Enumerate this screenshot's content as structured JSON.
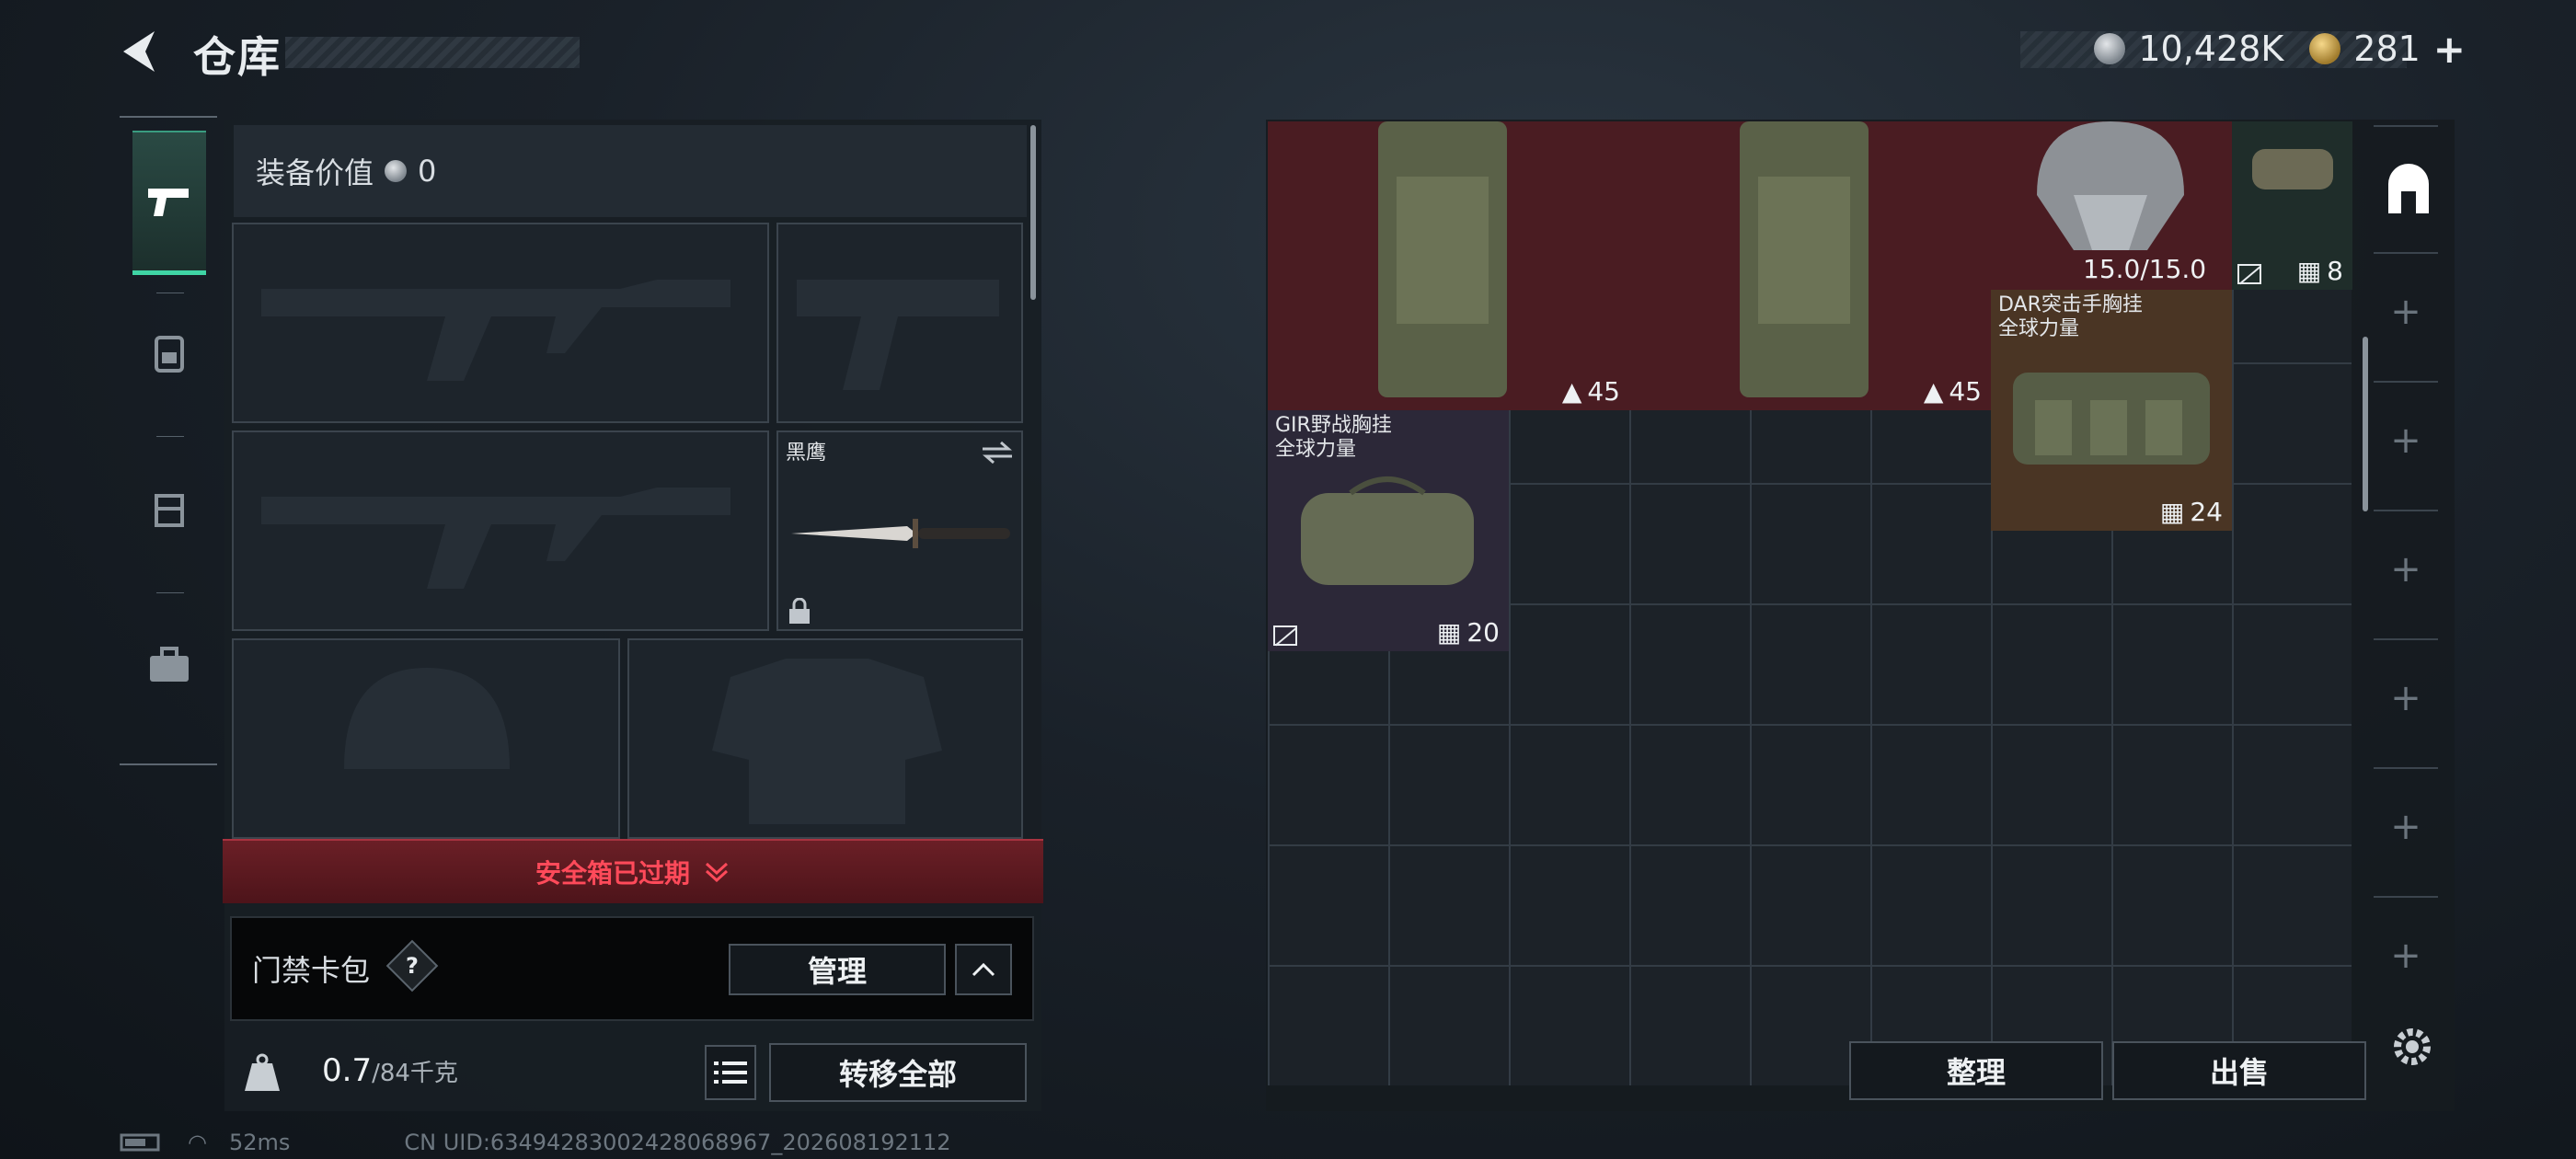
{
  "header": {
    "title": "仓库",
    "silver": "10,428K",
    "gold": "281"
  },
  "sidebar": {
    "tabs": [
      "pistol-icon",
      "backpack-icon",
      "chest-rig-icon",
      "toolbox-icon"
    ]
  },
  "equipment": {
    "value_label": "装备价值",
    "value": "0",
    "melee_name": "黑鹰",
    "safe_box_text": "安全箱已过期",
    "keycard_label": "门禁卡包",
    "help_symbol": "?",
    "manage_button": "管理",
    "weight_value": "0.7",
    "weight_max": "/84千克",
    "transfer_all_button": "转移全部"
  },
  "storage": {
    "items": [
      {
        "name": "",
        "count": "45"
      },
      {
        "name": "",
        "count": "45"
      },
      {
        "name": "",
        "durability": "15.0/15.0"
      },
      {
        "name": "",
        "count": "8"
      },
      {
        "name": "DAR突击手胸挂",
        "sub": "全球力量",
        "count": "24"
      },
      {
        "name": "GIR野战胸挂",
        "sub": "全球力量",
        "count": "20"
      }
    ],
    "sort_button": "整理",
    "sell_button": "出售"
  },
  "status": {
    "ping": "52ms",
    "uid": "CN UID:6349428300242806896​7_202608192112"
  },
  "colors": {
    "accent": "#3fd4a4",
    "danger": "#ff4a5a",
    "rarity_red": "#4a1c22",
    "rarity_orange": "#4a3524",
    "rarity_purple": "#2c2838"
  }
}
